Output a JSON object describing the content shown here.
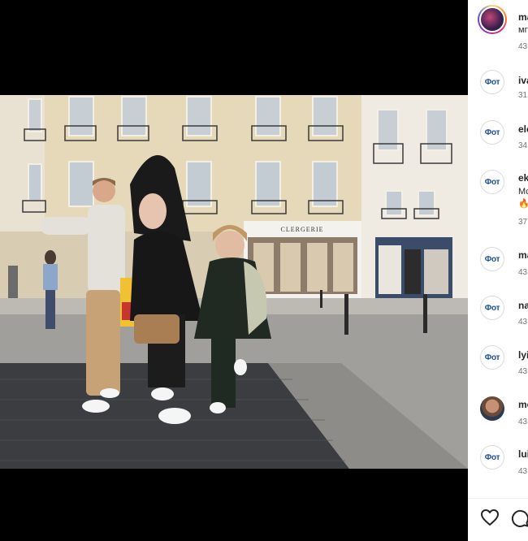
{
  "post": {
    "author": {
      "username": "ma",
      "caption": "мг",
      "time": "43"
    },
    "media": {
      "storefront_sign": "CLERGERIE",
      "mute_icon": "speaker-muted-icon"
    }
  },
  "comments": [
    {
      "username": "iva",
      "time": "31",
      "avatar_label": "Фот",
      "avatar_type": "generic"
    },
    {
      "username": "ele",
      "time": "34",
      "avatar_label": "Фот",
      "avatar_type": "generic"
    },
    {
      "username": "ek",
      "text": "Мс",
      "emoji": "🔥",
      "time": "37",
      "avatar_label": "Фот",
      "avatar_type": "generic"
    },
    {
      "username": "ma",
      "time": "43",
      "avatar_label": "Фот",
      "avatar_type": "generic"
    },
    {
      "username": "na",
      "time": "43",
      "avatar_label": "Фот",
      "avatar_type": "generic"
    },
    {
      "username": "lyi",
      "time": "43",
      "avatar_label": "Фот",
      "avatar_type": "generic"
    },
    {
      "username": "mc",
      "time": "43",
      "avatar_type": "photo"
    },
    {
      "username": "lui",
      "time": "43",
      "avatar_label": "Фот",
      "avatar_type": "generic"
    }
  ],
  "actions": {
    "like_icon": "heart-icon",
    "comment_icon": "comment-bubble-icon"
  },
  "colors": {
    "background": "#000000",
    "panel": "#ffffff",
    "text": "#262626",
    "muted_text": "#737373",
    "avatar_label": "#1f4f9c"
  }
}
